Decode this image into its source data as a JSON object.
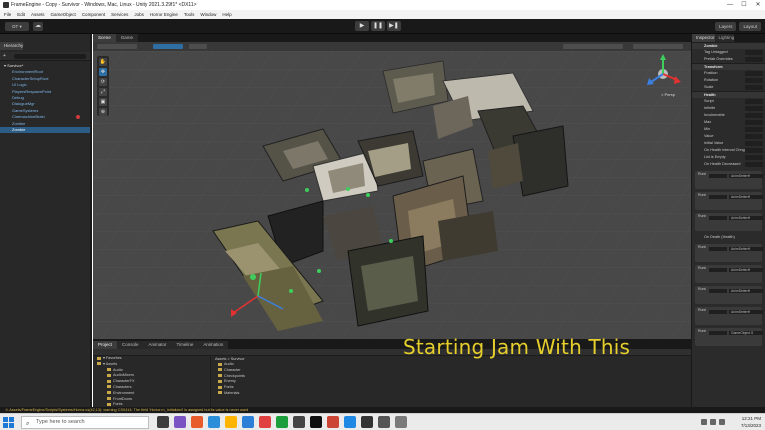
{
  "window": {
    "title": "FrameEngine - Copy - Survivor - Windows, Mac, Linux - Unity 2021.3.29f1* <DX11>",
    "controls": [
      "—",
      "☐",
      "✕"
    ]
  },
  "menu": [
    "File",
    "Edit",
    "Assets",
    "GameObject",
    "Component",
    "Services",
    "Jobs",
    "Horror Engine",
    "Tools",
    "Window",
    "Help"
  ],
  "toolbar": {
    "account": "DT ▾",
    "play": [
      "▶",
      "❚❚",
      "▶❚"
    ],
    "right": [
      "Layers",
      "Layout"
    ]
  },
  "hierarchy": {
    "tab": "Hierarchy",
    "items": [
      {
        "label": "▾ Survivor*",
        "kind": "root"
      },
      {
        "label": "EnvironmentRoot",
        "kind": "obj"
      },
      {
        "label": "CharacterSetupRoot",
        "kind": "obj"
      },
      {
        "label": "UI Logic",
        "kind": "obj"
      },
      {
        "label": "PlayersRespawnPoint",
        "kind": "obj"
      },
      {
        "label": "Debug",
        "kind": "obj"
      },
      {
        "label": "DialogueMgr",
        "kind": "obj"
      },
      {
        "label": "GameSystems",
        "kind": "obj"
      },
      {
        "label": "CinemachineBrain",
        "kind": "obj",
        "warn": true
      },
      {
        "label": "Zombie",
        "kind": "obj"
      },
      {
        "label": "Zombie",
        "kind": "sel"
      }
    ]
  },
  "scene": {
    "tabs": [
      "Scene",
      "Game"
    ],
    "gizmo_label": "< Persp",
    "tools": [
      "✋",
      "✥",
      "⟳",
      "⤢",
      "▣",
      "⊕"
    ]
  },
  "inspector": {
    "tabs": [
      "Inspector",
      "Lighting"
    ],
    "rows": [
      {
        "label": "Zombie",
        "head": true
      },
      {
        "label": "Tag  Untagged"
      },
      {
        "label": "Prefab  Overrides"
      },
      {
        "label": "Transform",
        "head": true
      },
      {
        "label": "Position"
      },
      {
        "label": "Rotation"
      },
      {
        "label": "Scale"
      },
      {
        "label": "Health",
        "head": true
      },
      {
        "label": "Script"
      },
      {
        "label": "Infinite"
      },
      {
        "label": "Invulnerable"
      },
      {
        "label": "Max"
      },
      {
        "label": "Min"
      },
      {
        "label": "Value"
      },
      {
        "label": "Initial Value"
      },
      {
        "label": "On Health Interval Chngd"
      },
      {
        "label": "List is Empty"
      },
      {
        "label": "On Health Decreased"
      }
    ],
    "events": [
      {
        "title": "",
        "a": "Runt",
        "b": "AnimSetterH"
      },
      {
        "title": "",
        "a": "Runt",
        "b": "AnimSetterH"
      },
      {
        "title": "",
        "a": "Runt",
        "b": "AnimSetterH"
      },
      {
        "title": "On Death (Health)",
        "a": "Runt",
        "b": "AnimSetterH"
      },
      {
        "title": "",
        "a": "Runt",
        "b": "AnimSetterH"
      },
      {
        "title": "",
        "a": "Runt",
        "b": "AnimSetterH"
      },
      {
        "title": "",
        "a": "Runt",
        "b": "AnimSetterH"
      },
      {
        "title": "",
        "a": "Runt",
        "b": "GameObject.S"
      }
    ]
  },
  "project": {
    "tabs": [
      "Project",
      "Console",
      "Animator",
      "Timeline",
      "Animation"
    ],
    "tree": [
      "▾ Favorites",
      "▾ Assets",
      "Audio",
      "AudioMixers",
      "CharacterFX",
      "Characters",
      "Environment",
      "FrontDoors",
      "Fonts",
      "Materials",
      "Player"
    ],
    "breadcrumb": "Assets > Survivor",
    "files": [
      "Audio",
      "Character",
      "Checkpoints",
      "Enemy",
      "Fonts",
      "Materials"
    ]
  },
  "overlay_text": "Starting Jam With This",
  "status": "⚠ Assets/FrameEngine/Scripts/Systems/Horror.cs(42,13): warning CS0414: The field 'Horror.m_Initialized' is assigned but its value is never used",
  "taskbar": {
    "search_placeholder": "Type here to search",
    "time": "12:21 PM",
    "date": "7/13/2023",
    "icon_colors": [
      "#3c3c3c",
      "#7b54c3",
      "#e85b2a",
      "#2a8ed8",
      "#ffb400",
      "#2b7fd6",
      "#e04040",
      "#1b9e3c",
      "#444444",
      "#0f0f0f",
      "#c43",
      "#1e88e5",
      "#333333",
      "#555555",
      "#7a7a7a"
    ]
  },
  "colors": {
    "accent": "#2c5d87",
    "overlay": "#e6cf2c",
    "scene_bg": "#4a4a4a"
  }
}
